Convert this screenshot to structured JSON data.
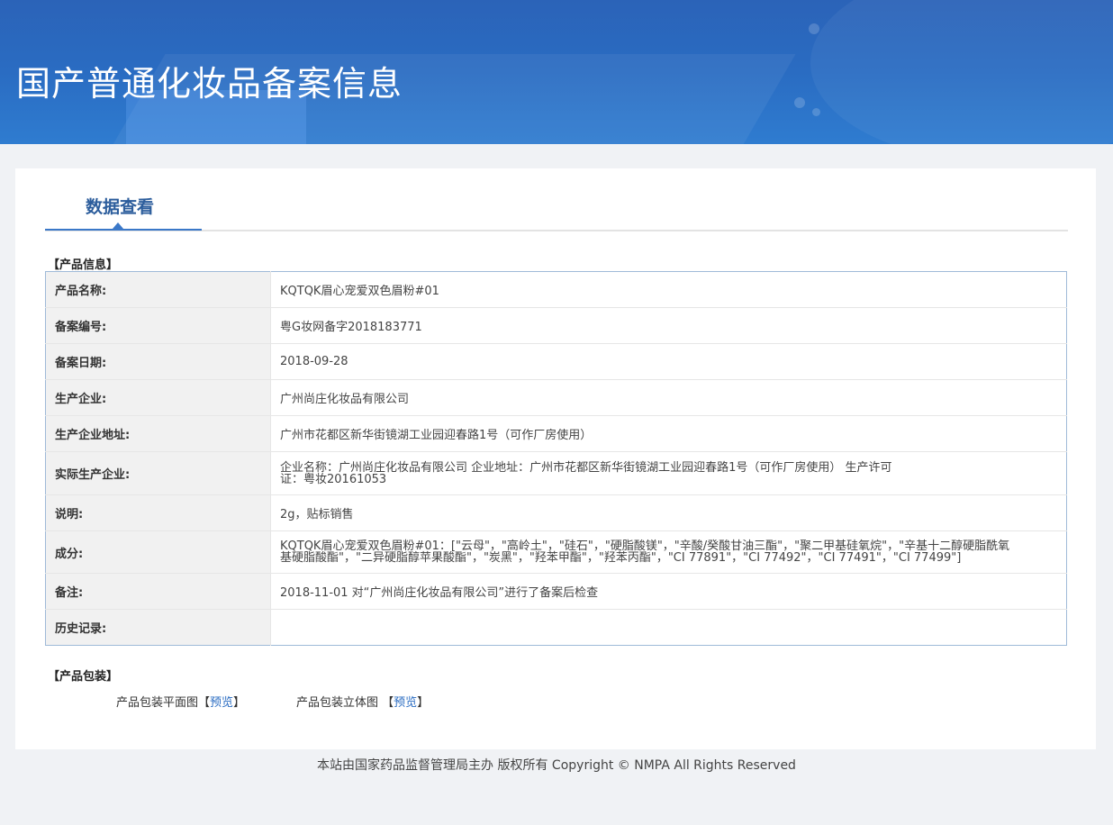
{
  "banner": {
    "title": "国产普通化妆品备案信息"
  },
  "tabs": {
    "active_label": "数据查看"
  },
  "product_info": {
    "section_title": "【产品信息】",
    "rows": [
      {
        "label": "产品名称:",
        "value": "KQTQK眉心宠爱双色眉粉#01"
      },
      {
        "label": "备案编号:",
        "value": "粤G妆网备字2018183771"
      },
      {
        "label": "备案日期:",
        "value": "2018-09-28"
      },
      {
        "label": "生产企业:",
        "value": "广州尚庄化妆品有限公司"
      },
      {
        "label": "生产企业地址:",
        "value": "广州市花都区新华街镜湖工业园迎春路1号（可作厂房使用）"
      },
      {
        "label": "实际生产企业:",
        "value": "企业名称：广州尚庄化妆品有限公司 企业地址：广州市花都区新华街镜湖工业园迎春路1号（可作厂房使用） 生产许可证：粤妆20161053"
      },
      {
        "label": "说明:",
        "value": "2g，贴标销售"
      },
      {
        "label": "成分:",
        "value": "KQTQK眉心宠爱双色眉粉#01：[\"云母\"，\"高岭土\"，\"硅石\"，\"硬脂酸镁\"，\"辛酸/癸酸甘油三酯\"，\"聚二甲基硅氧烷\"，\"辛基十二醇硬脂酰氧基硬脂酸酯\"，\"二异硬脂醇苹果酸酯\"，\"炭黑\"，\"羟苯甲酯\"，\"羟苯丙酯\"，\"CI 77891\"，\"CI 77492\"，\"CI 77491\"，\"CI 77499\"]"
      },
      {
        "label": "备注:",
        "value": "2018-11-01 对“广州尚庄化妆品有限公司”进行了备案后检查"
      },
      {
        "label": "历史记录:",
        "value": ""
      }
    ]
  },
  "packaging": {
    "section_title": "【产品包装】",
    "flat_label": "产品包装平面图",
    "flat_link": "预览",
    "solid_label": "产品包装立体图",
    "solid_link": "预览"
  },
  "footer": {
    "text": "本站由国家药品监督管理局主办 版权所有 Copyright © NMPA All Rights Reserved"
  }
}
